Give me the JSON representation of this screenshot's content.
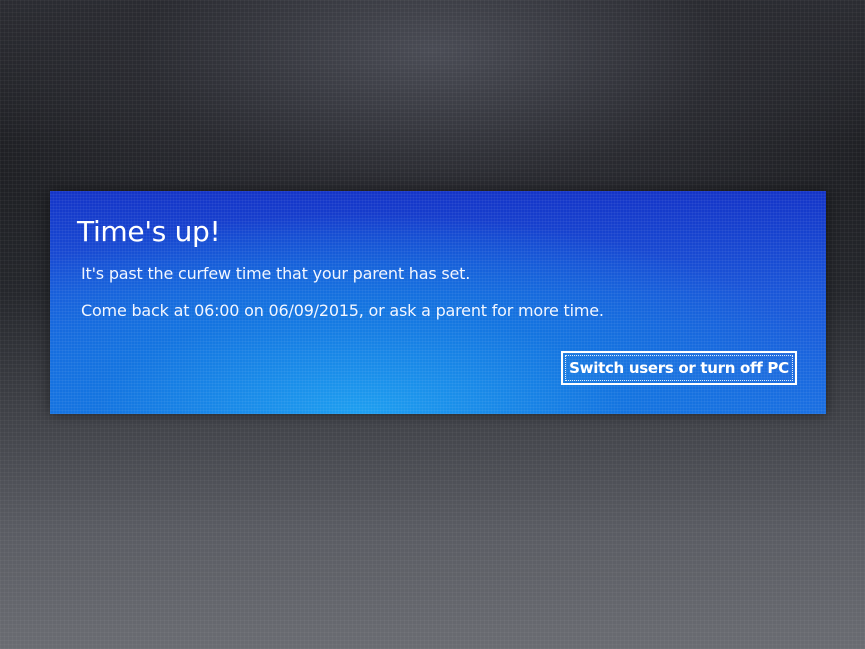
{
  "dialog": {
    "title": "Time's up!",
    "message_line1": "It's past the curfew time that your parent has set.",
    "message_line2": "Come back at 06:00 on 06/09/2015, or ask a parent for more time.",
    "button_label": "Switch users or turn off PC"
  },
  "colors": {
    "dialog_background": "#1a56d8",
    "dialog_highlight": "#1e9ff0",
    "text": "#ffffff",
    "screen_background": "#25272c"
  }
}
